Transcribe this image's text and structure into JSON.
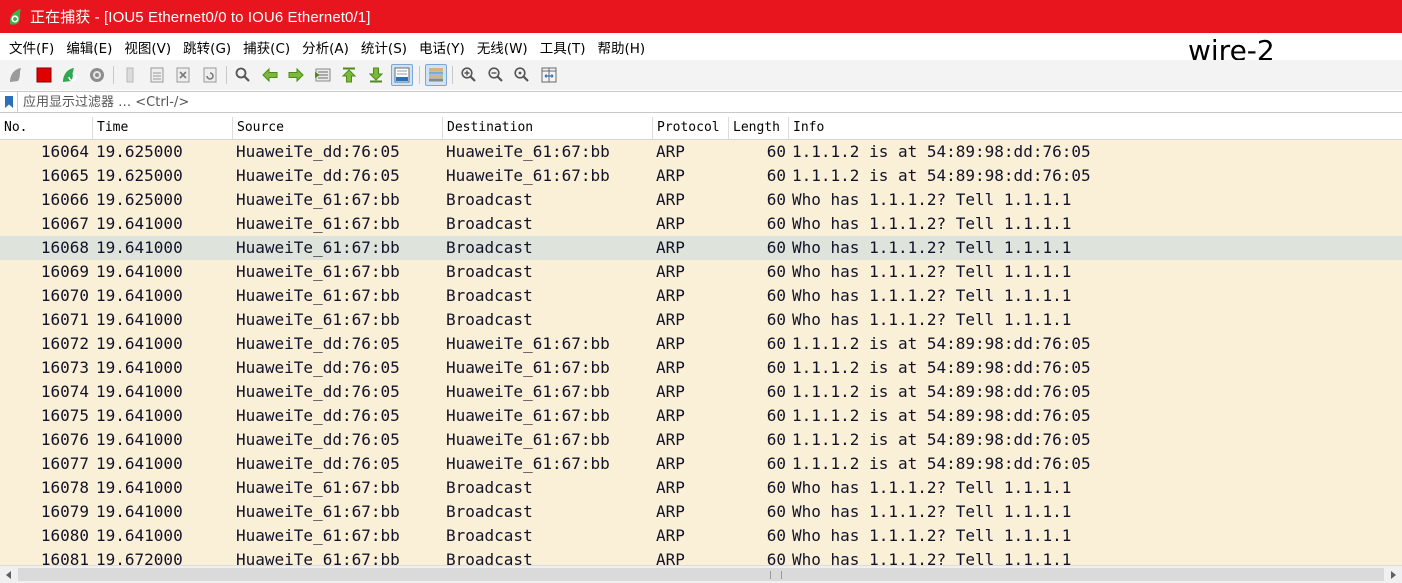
{
  "window": {
    "title": "正在捕获 - [IOU5 Ethernet0/0 to IOU6 Ethernet0/1]"
  },
  "annotation": "wire-2",
  "menu": [
    {
      "label": "文件(F)"
    },
    {
      "label": "编辑(E)"
    },
    {
      "label": "视图(V)"
    },
    {
      "label": "跳转(G)"
    },
    {
      "label": "捕获(C)"
    },
    {
      "label": "分析(A)"
    },
    {
      "label": "统计(S)"
    },
    {
      "label": "电话(Y)"
    },
    {
      "label": "无线(W)"
    },
    {
      "label": "工具(T)"
    },
    {
      "label": "帮助(H)"
    }
  ],
  "toolbar": {
    "icons": [
      "start-capture-icon",
      "stop-capture-icon",
      "restart-capture-icon",
      "capture-options-icon",
      "open-file-icon",
      "save-file-icon",
      "close-file-icon",
      "reload-file-icon",
      "find-packet-icon",
      "go-back-icon",
      "go-forward-icon",
      "go-to-packet-icon",
      "go-first-icon",
      "go-last-icon",
      "autoscroll-icon",
      "colorize-icon",
      "zoom-in-icon",
      "zoom-out-icon",
      "zoom-normal-icon",
      "resize-columns-icon"
    ]
  },
  "filter": {
    "placeholder": "应用显示过滤器 … <Ctrl-/>"
  },
  "columns": {
    "no": "No.",
    "time": "Time",
    "source": "Source",
    "destination": "Destination",
    "protocol": "Protocol",
    "length": "Length",
    "info": "Info"
  },
  "packets": [
    {
      "no": "16064",
      "time": "19.625000",
      "source": "HuaweiTe_dd:76:05",
      "destination": "HuaweiTe_61:67:bb",
      "protocol": "ARP",
      "length": "60",
      "info": "1.1.1.2 is at 54:89:98:dd:76:05"
    },
    {
      "no": "16065",
      "time": "19.625000",
      "source": "HuaweiTe_dd:76:05",
      "destination": "HuaweiTe_61:67:bb",
      "protocol": "ARP",
      "length": "60",
      "info": "1.1.1.2 is at 54:89:98:dd:76:05"
    },
    {
      "no": "16066",
      "time": "19.625000",
      "source": "HuaweiTe_61:67:bb",
      "destination": "Broadcast",
      "protocol": "ARP",
      "length": "60",
      "info": "Who has 1.1.1.2? Tell 1.1.1.1"
    },
    {
      "no": "16067",
      "time": "19.641000",
      "source": "HuaweiTe_61:67:bb",
      "destination": "Broadcast",
      "protocol": "ARP",
      "length": "60",
      "info": "Who has 1.1.1.2? Tell 1.1.1.1"
    },
    {
      "no": "16068",
      "time": "19.641000",
      "source": "HuaweiTe_61:67:bb",
      "destination": "Broadcast",
      "protocol": "ARP",
      "length": "60",
      "info": "Who has 1.1.1.2? Tell 1.1.1.1",
      "selected": true
    },
    {
      "no": "16069",
      "time": "19.641000",
      "source": "HuaweiTe_61:67:bb",
      "destination": "Broadcast",
      "protocol": "ARP",
      "length": "60",
      "info": "Who has 1.1.1.2? Tell 1.1.1.1"
    },
    {
      "no": "16070",
      "time": "19.641000",
      "source": "HuaweiTe_61:67:bb",
      "destination": "Broadcast",
      "protocol": "ARP",
      "length": "60",
      "info": "Who has 1.1.1.2? Tell 1.1.1.1"
    },
    {
      "no": "16071",
      "time": "19.641000",
      "source": "HuaweiTe_61:67:bb",
      "destination": "Broadcast",
      "protocol": "ARP",
      "length": "60",
      "info": "Who has 1.1.1.2? Tell 1.1.1.1"
    },
    {
      "no": "16072",
      "time": "19.641000",
      "source": "HuaweiTe_dd:76:05",
      "destination": "HuaweiTe_61:67:bb",
      "protocol": "ARP",
      "length": "60",
      "info": "1.1.1.2 is at 54:89:98:dd:76:05"
    },
    {
      "no": "16073",
      "time": "19.641000",
      "source": "HuaweiTe_dd:76:05",
      "destination": "HuaweiTe_61:67:bb",
      "protocol": "ARP",
      "length": "60",
      "info": "1.1.1.2 is at 54:89:98:dd:76:05"
    },
    {
      "no": "16074",
      "time": "19.641000",
      "source": "HuaweiTe_dd:76:05",
      "destination": "HuaweiTe_61:67:bb",
      "protocol": "ARP",
      "length": "60",
      "info": "1.1.1.2 is at 54:89:98:dd:76:05"
    },
    {
      "no": "16075",
      "time": "19.641000",
      "source": "HuaweiTe_dd:76:05",
      "destination": "HuaweiTe_61:67:bb",
      "protocol": "ARP",
      "length": "60",
      "info": "1.1.1.2 is at 54:89:98:dd:76:05"
    },
    {
      "no": "16076",
      "time": "19.641000",
      "source": "HuaweiTe_dd:76:05",
      "destination": "HuaweiTe_61:67:bb",
      "protocol": "ARP",
      "length": "60",
      "info": "1.1.1.2 is at 54:89:98:dd:76:05"
    },
    {
      "no": "16077",
      "time": "19.641000",
      "source": "HuaweiTe_dd:76:05",
      "destination": "HuaweiTe_61:67:bb",
      "protocol": "ARP",
      "length": "60",
      "info": "1.1.1.2 is at 54:89:98:dd:76:05"
    },
    {
      "no": "16078",
      "time": "19.641000",
      "source": "HuaweiTe_61:67:bb",
      "destination": "Broadcast",
      "protocol": "ARP",
      "length": "60",
      "info": "Who has 1.1.1.2? Tell 1.1.1.1"
    },
    {
      "no": "16079",
      "time": "19.641000",
      "source": "HuaweiTe_61:67:bb",
      "destination": "Broadcast",
      "protocol": "ARP",
      "length": "60",
      "info": "Who has 1.1.1.2? Tell 1.1.1.1"
    },
    {
      "no": "16080",
      "time": "19.641000",
      "source": "HuaweiTe_61:67:bb",
      "destination": "Broadcast",
      "protocol": "ARP",
      "length": "60",
      "info": "Who has 1.1.1.2? Tell 1.1.1.1"
    },
    {
      "no": "16081",
      "time": "19.672000",
      "source": "HuaweiTe_61:67:bb",
      "destination": "Broadcast",
      "protocol": "ARP",
      "length": "60",
      "info": "Who has 1.1.1.2? Tell 1.1.1.1"
    }
  ],
  "colors": {
    "titlebar": "#e8151e",
    "row_background": "#faf0d7",
    "row_selected": "#dee3dc",
    "row_text": "#12122a"
  }
}
